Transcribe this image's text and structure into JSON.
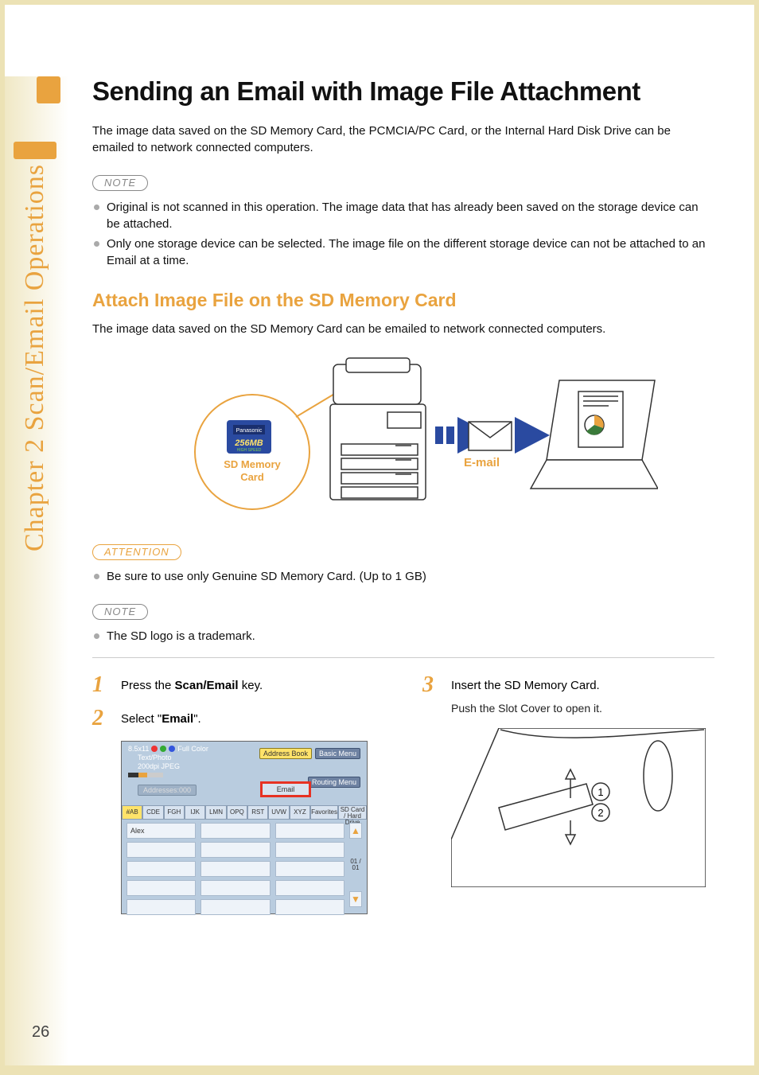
{
  "sidebar": {
    "text": "Chapter 2  Scan/Email Operations"
  },
  "title": "Sending an Email with Image File Attachment",
  "intro": "The image data saved on the SD Memory Card, the PCMCIA/PC Card, or the Internal Hard Disk Drive can be emailed to network connected computers.",
  "labels": {
    "note": "NOTE",
    "attention": "ATTENTION"
  },
  "notes_top": [
    "Original is not scanned in this operation. The image data that has already been saved on the storage device can be attached.",
    "Only one storage device can be selected. The image file on the different storage device can not be attached to an Email at a time."
  ],
  "subhead": "Attach Image File on the SD Memory Card",
  "subhead_body": "The image data saved on the SD Memory Card can be emailed to network connected computers.",
  "diagram": {
    "sd_line1": "SD Memory",
    "sd_line2": "Card",
    "sd_size": "256MB",
    "sd_sub": "HIGH SPEED",
    "sd_brand": "Panasonic",
    "email": "E-mail"
  },
  "attention_items": [
    "Be sure to use only Genuine SD Memory Card. (Up to 1 GB)"
  ],
  "notes_bottom": [
    "The SD logo is a trademark."
  ],
  "steps": {
    "s1": {
      "num": "1",
      "pre": "Press the ",
      "bold": "Scan/Email",
      "post": " key."
    },
    "s2": {
      "num": "2",
      "pre": "Select \"",
      "bold": "Email",
      "post": "\"."
    },
    "s3": {
      "num": "3",
      "main": "Insert the SD Memory Card.",
      "sub": "Push the Slot Cover to open it."
    }
  },
  "screen": {
    "paper": "8.5x11",
    "mode_color": "Full Color",
    "mode_type": "Text/Photo",
    "mode_res": "200dpi JPEG",
    "addresses": "Addresses:000",
    "btn_addressbook": "Address Book",
    "btn_basic": "Basic Menu",
    "btn_email": "Email",
    "btn_routing": "Routing Menu",
    "tabs": [
      "#AB",
      "CDE",
      "FGH",
      "IJK",
      "LMN",
      "OPQ",
      "RST",
      "UVW",
      "XYZ",
      "Favorites",
      "SD Card / Hard Drive"
    ],
    "entry": "Alex",
    "page": "01 / 01"
  },
  "slot": {
    "c1": "1",
    "c2": "2"
  },
  "pagenum": "26"
}
